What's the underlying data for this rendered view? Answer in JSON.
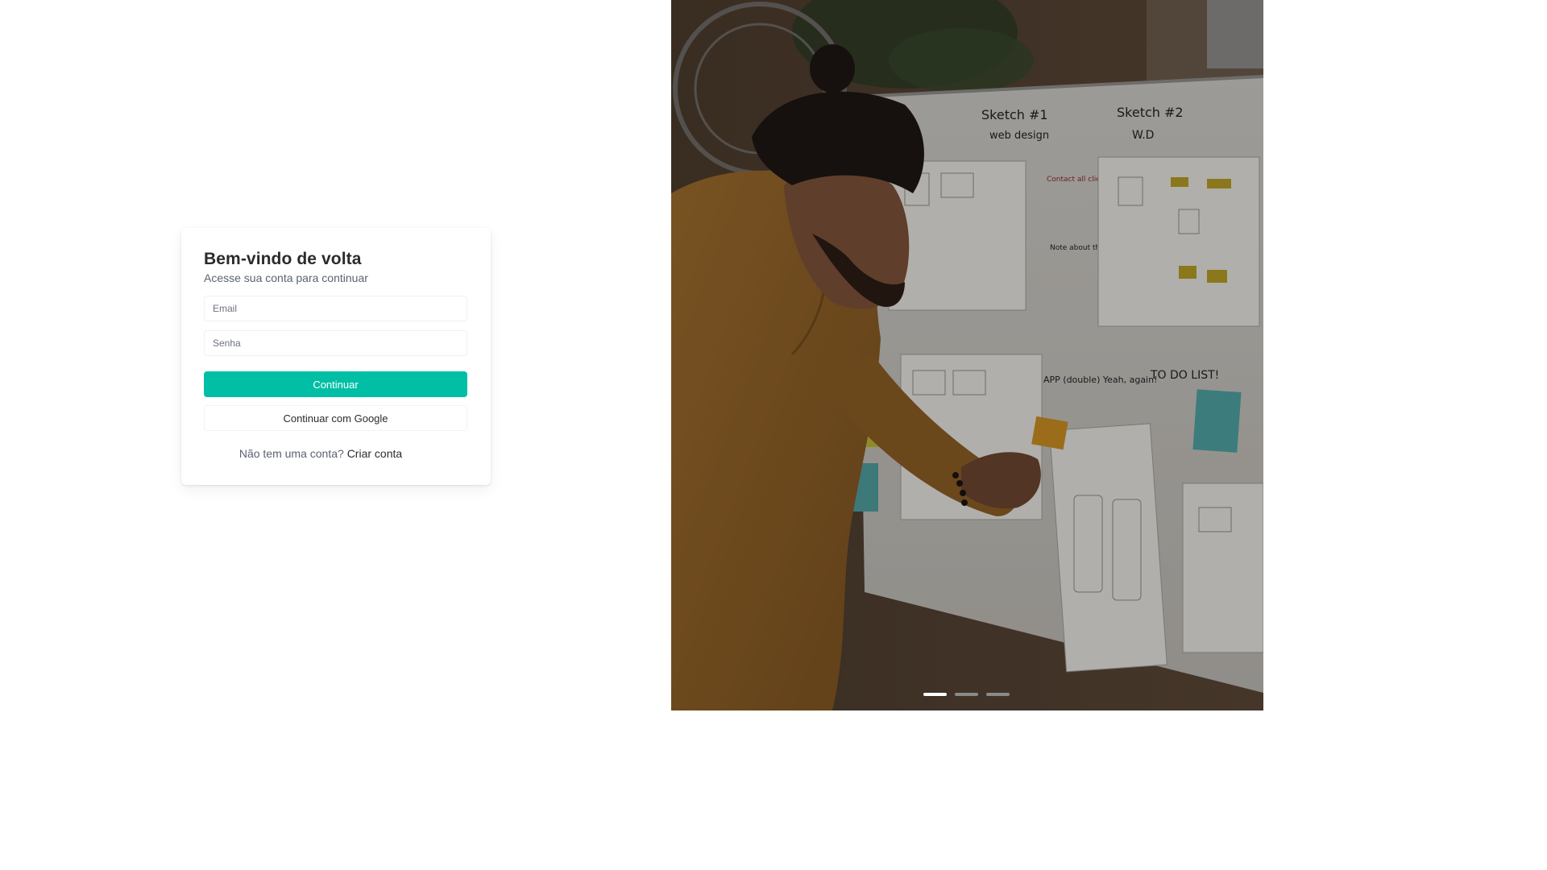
{
  "login": {
    "title": "Bem-vindo de volta",
    "subtitle": "Acesse sua conta para continuar",
    "email_placeholder": "Email",
    "password_placeholder": "Senha",
    "continue_label": "Continuar",
    "google_label": "Continuar com Google",
    "signup_prompt": "Não tem uma conta?",
    "signup_link": "Criar conta"
  },
  "theme": {
    "accent": "#00bfa5",
    "card_bg": "#ffffff",
    "page_bg": "#ffffff"
  },
  "hero": {
    "image": "designer-at-whiteboard-photo",
    "whiteboard_text": {
      "sketch1_title": "Sketch #1",
      "sketch1_sub": "web design",
      "sketch2_title": "Sketch #2",
      "sketch2_sub": "W.D",
      "note_contact": "Contact all clients soon!",
      "note_interface": "Note about the interface #1",
      "note_todo": "TO DO LIST!",
      "note_app": "APP (double) Yeah, again!"
    },
    "carousel": {
      "count": 3,
      "active_index": 0
    }
  }
}
